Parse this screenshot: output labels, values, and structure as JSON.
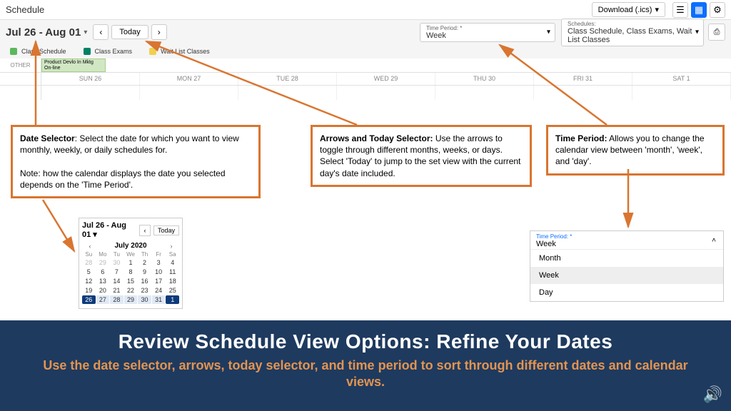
{
  "header": {
    "title": "Schedule",
    "download_label": "Download (.ics)"
  },
  "date_row": {
    "range": "Jul 26 - Aug 01",
    "today_label": "Today",
    "time_period": {
      "lbl": "Time Period: *",
      "val": "Week"
    },
    "schedules": {
      "lbl": "Schedules:",
      "val": "Class Schedule, Class Exams, Wait List Classes"
    }
  },
  "legend": {
    "a": "Class Schedule",
    "b": "Class Exams",
    "c": "Wait List Classes"
  },
  "calendar": {
    "other_label": "OTHER",
    "event": "Product Devlo In Mktg\nOn-line",
    "days": [
      "SUN 26",
      "MON 27",
      "TUE 28",
      "WED 29",
      "THU 30",
      "FRI 31",
      "SAT 1"
    ]
  },
  "callouts": {
    "c1_title": "Date Selector",
    "c1_body": ": Select the date for which you want to view monthly, weekly, or daily schedules for.",
    "c1_note": "Note: how the calendar displays the date you selected depends on the 'Time Period'.",
    "c2_title": "Arrows and Today Selector:",
    "c2_body": " Use the arrows to toggle through different months, weeks, or days. Select 'Today' to jump to the set view with the current day's date included.",
    "c3_title": "Time Period:",
    "c3_body": " Allows you to change the calendar view between 'month', 'week', and 'day'."
  },
  "mini_cal": {
    "range": "Jul 26 - Aug 01",
    "today": "Today",
    "month": "July 2020",
    "dow": [
      "Su",
      "Mo",
      "Tu",
      "We",
      "Th",
      "Fr",
      "Sa"
    ],
    "rows": [
      [
        "28",
        "29",
        "30",
        "1",
        "2",
        "3",
        "4"
      ],
      [
        "5",
        "6",
        "7",
        "8",
        "9",
        "10",
        "11"
      ],
      [
        "12",
        "13",
        "14",
        "15",
        "16",
        "17",
        "18"
      ],
      [
        "19",
        "20",
        "21",
        "22",
        "23",
        "24",
        "25"
      ],
      [
        "26",
        "27",
        "28",
        "29",
        "30",
        "31",
        "1"
      ]
    ]
  },
  "tp_popout": {
    "lbl": "Time Period: *",
    "val": "Week",
    "opts": [
      "Month",
      "Week",
      "Day"
    ]
  },
  "banner": {
    "title": "Review Schedule View Options: Refine Your Dates",
    "sub": "Use the date selector, arrows, today selector, and time period to sort through different dates and calendar views."
  }
}
